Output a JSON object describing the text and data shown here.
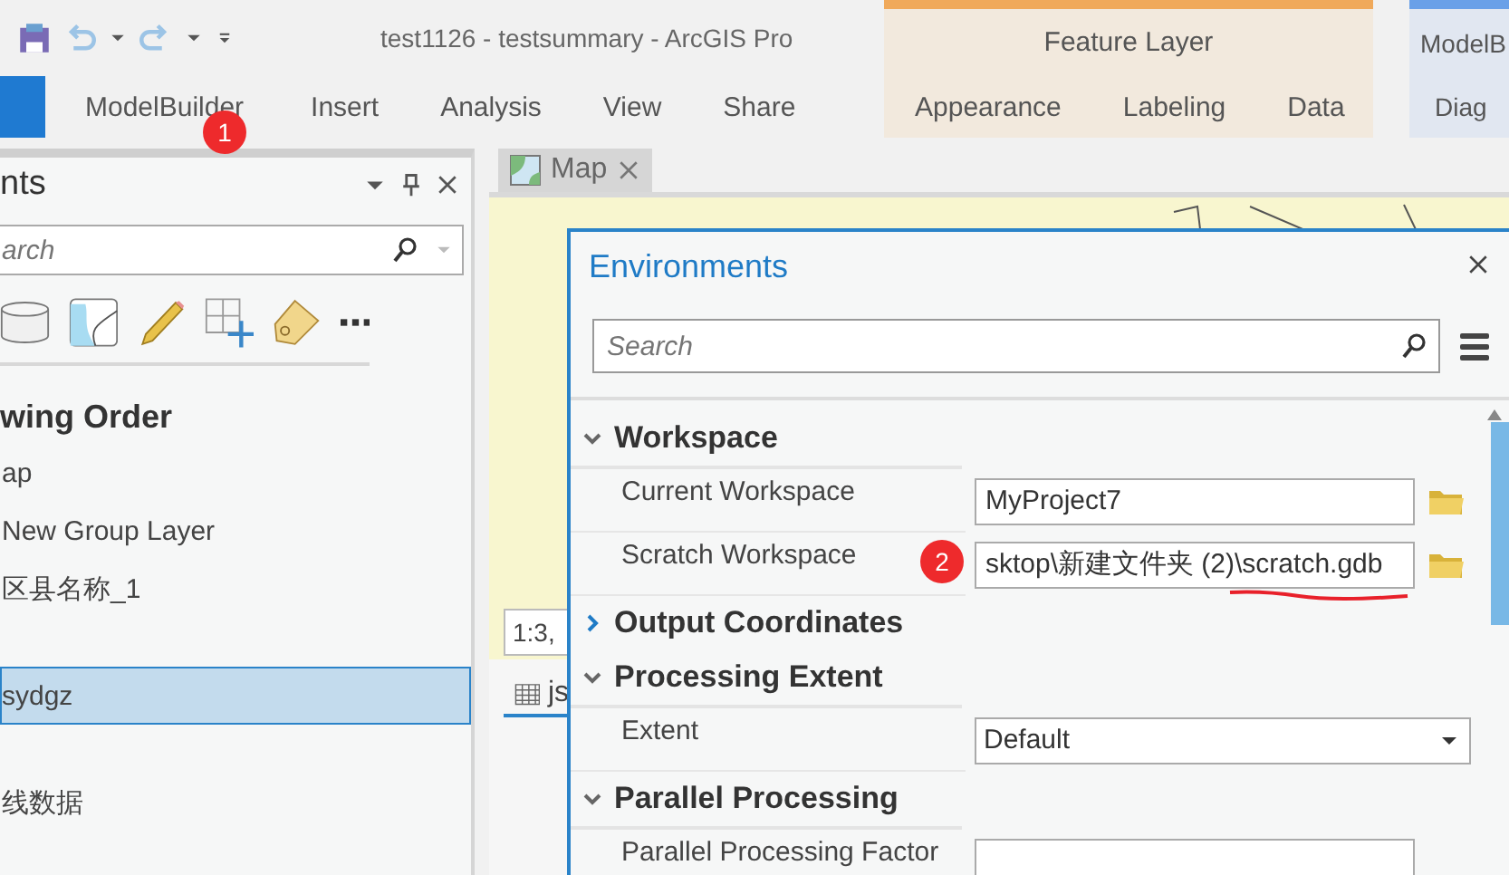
{
  "title_bar": {
    "title": "test1126 - testsummary - ArcGIS Pro"
  },
  "ribbon": {
    "tabs": [
      {
        "selected": true
      },
      {
        "label": "ModelBuilder",
        "selected": false,
        "badge": "1"
      },
      {
        "label": "Insert",
        "selected": false
      },
      {
        "label": "Analysis",
        "selected": false
      },
      {
        "label": "View",
        "selected": false
      },
      {
        "label": "Share",
        "selected": false
      }
    ],
    "contextual_groups": [
      {
        "label": "Feature Layer",
        "color": "#f0a95a",
        "tabs": [
          {
            "label": "Appearance",
            "selected": false
          },
          {
            "label": "Labeling",
            "selected": false
          },
          {
            "label": "Data",
            "selected": false
          }
        ]
      },
      {
        "label": "ModelB",
        "color": "#6aa0e8",
        "tabs": [
          {
            "label": "Diag",
            "selected": false
          }
        ]
      }
    ]
  },
  "contents_pane": {
    "title": "nts",
    "search": {
      "placeholder": "arch"
    },
    "heading": "wing Order",
    "items": [
      {
        "kind": "layer",
        "label": "ap",
        "selected": false
      },
      {
        "kind": "layer",
        "label": "New Group Layer",
        "selected": false
      },
      {
        "kind": "layer",
        "label": "区县名称_1",
        "selected": false
      },
      {
        "kind": "blank"
      },
      {
        "kind": "layer",
        "label": "sydgz",
        "selected": true
      },
      {
        "kind": "blank"
      },
      {
        "kind": "layer",
        "label": "线数据",
        "selected": false
      }
    ]
  },
  "map_view": {
    "tab": {
      "label": "Map"
    },
    "scale": "1:3,",
    "table_tab": {
      "label": "js"
    }
  },
  "environments_dialog": {
    "title": "Environments",
    "search": {
      "placeholder": "Search"
    },
    "sections": [
      {
        "title": "Workspace",
        "expanded": true,
        "settings": [
          {
            "label": "Current Workspace",
            "kind": "path",
            "value": "MyProject7"
          },
          {
            "label": "Scratch Workspace",
            "kind": "path",
            "value": "sktop\\新建文件夹 (2)\\scratch.gdb",
            "badge": "2",
            "underlined": true
          }
        ]
      },
      {
        "title": "Output Coordinates",
        "expanded": false
      },
      {
        "title": "Processing Extent",
        "expanded": true,
        "settings": [
          {
            "label": "Extent",
            "kind": "dropdown",
            "value": "Default"
          }
        ]
      },
      {
        "title": "Parallel Processing",
        "expanded": true,
        "settings": [
          {
            "label": "Parallel Processing Factor",
            "kind": "text"
          }
        ]
      }
    ]
  }
}
